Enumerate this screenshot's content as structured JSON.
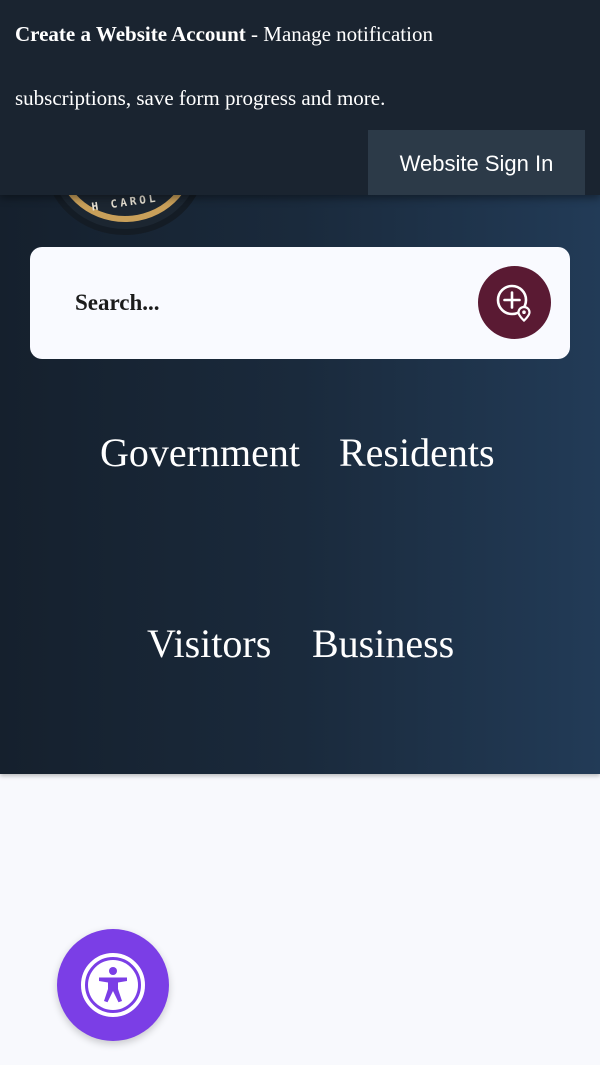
{
  "banner": {
    "title": "Create a Website Account",
    "separator": " - ",
    "description": "Manage notification subscriptions, save form progress and more.",
    "signin_label": "Website Sign In"
  },
  "logo": {
    "text": "H CAROL"
  },
  "search": {
    "placeholder": "Search..."
  },
  "nav": {
    "items": [
      {
        "label": "Government"
      },
      {
        "label": "Residents"
      },
      {
        "label": "Visitors"
      },
      {
        "label": "Business"
      }
    ]
  },
  "icons": {
    "search_button": "search-plus-location-icon",
    "accessibility": "accessibility-person-icon"
  },
  "colors": {
    "hero_start": "#15202d",
    "hero_end": "#223b57",
    "banner_bg": "#1a2430",
    "signin_bg": "#2c3a48",
    "search_button": "#5a1a33",
    "accessibility_button": "#7b3ee6",
    "logo_gold": "#c9a05a"
  }
}
